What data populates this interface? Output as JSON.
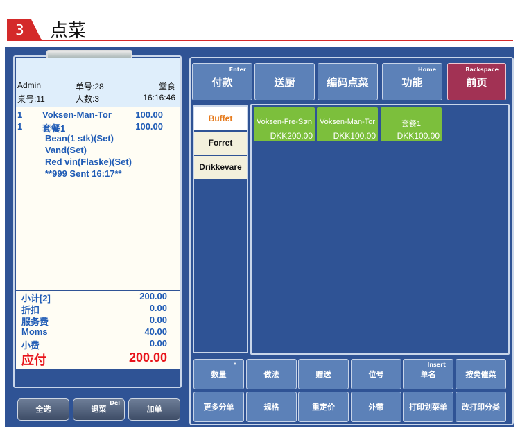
{
  "header": {
    "step": "3",
    "title": "点菜"
  },
  "ticket": {
    "user": "Admin",
    "order_no": "单号:28",
    "mode": "堂食",
    "table": "桌号:11",
    "guests": "人数:3",
    "time": "16:16:46",
    "lines": [
      {
        "qty": "1",
        "name": "Voksen-Man-Tor",
        "price": "100.00"
      },
      {
        "qty": "1",
        "name": "套餐1",
        "price": "100.00"
      },
      {
        "qty": "",
        "name": "Bean(1 stk)(Set)",
        "price": ""
      },
      {
        "qty": "",
        "name": "Vand(Set)",
        "price": ""
      },
      {
        "qty": "",
        "name": "Red vin(Flaske)(Set)",
        "price": ""
      },
      {
        "qty": "",
        "name": "**999 Sent 16:17**",
        "price": ""
      }
    ],
    "summary": [
      {
        "label": "小计[2]",
        "value": "200.00"
      },
      {
        "label": "折扣",
        "value": "0.00"
      },
      {
        "label": "服务费",
        "value": "0.00"
      },
      {
        "label": "Moms",
        "value": "40.00"
      },
      {
        "label": "小费",
        "value": "0.00"
      }
    ],
    "total_label": "应付",
    "total_value": "200.00"
  },
  "left_buttons": {
    "select_all": "全选",
    "return": "退菜",
    "return_hint": "Del",
    "add_order": "加单"
  },
  "function_buttons": [
    {
      "label": "付款",
      "hint": "Enter"
    },
    {
      "label": "送厨",
      "hint": ""
    },
    {
      "label": "编码点菜",
      "hint": ""
    },
    {
      "label": "功能",
      "hint": "Home"
    },
    {
      "label": "前页",
      "hint": "Backspace"
    }
  ],
  "categories": [
    {
      "label": "Buffet",
      "active": true
    },
    {
      "label": "Forret",
      "active": false
    },
    {
      "label": "Drikkevare",
      "active": false
    }
  ],
  "items": [
    {
      "name": "Voksen-Fre-Søn",
      "price": "DKK200.00"
    },
    {
      "name": "Voksen-Man-Tor",
      "price": "DKK100.00"
    },
    {
      "name": "套餐1",
      "price": "DKK100.00"
    }
  ],
  "bottom_buttons": [
    {
      "label": "数量",
      "hint": "*"
    },
    {
      "label": "做法",
      "hint": ""
    },
    {
      "label": "赠送",
      "hint": ""
    },
    {
      "label": "位号",
      "hint": ""
    },
    {
      "label": "单名",
      "hint": "Insert"
    },
    {
      "label": "按类催菜",
      "hint": ""
    },
    {
      "label": "更多分单",
      "hint": ""
    },
    {
      "label": "规格",
      "hint": ""
    },
    {
      "label": "重定价",
      "hint": ""
    },
    {
      "label": "外带",
      "hint": ""
    },
    {
      "label": "打印划菜单",
      "hint": ""
    },
    {
      "label": "改打印分类",
      "hint": ""
    }
  ],
  "colors": {
    "app_bg": "#2f5395",
    "button": "#5c81b8",
    "back_button": "#a23254",
    "item": "#7cbf3c",
    "accent_red": "#d42a2a",
    "total_red": "#e8141b",
    "ticket_text": "#1f5bb5"
  }
}
